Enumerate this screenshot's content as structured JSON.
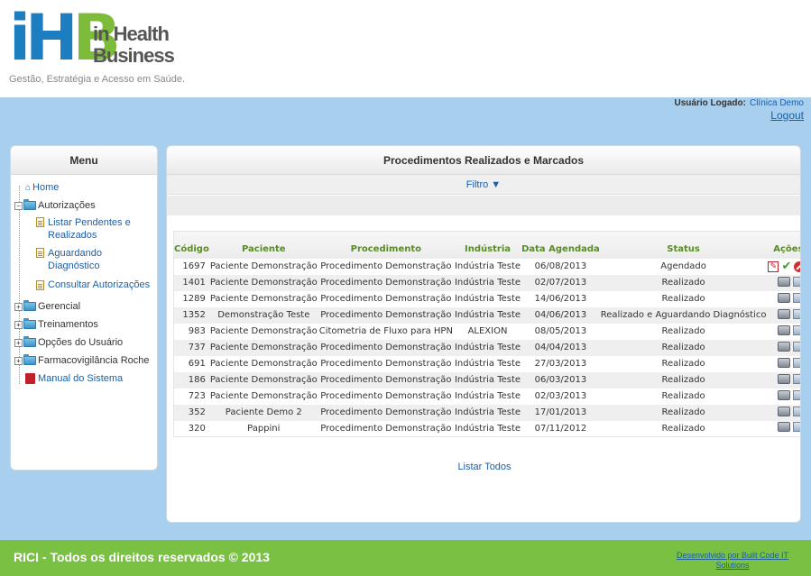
{
  "brand": {
    "letters": [
      "i",
      "H",
      "B"
    ],
    "line1": "in Health",
    "line2": "Business",
    "tagline": "Gestão, Estratégia e Acesso em Saúde.",
    "colors": {
      "blue": "#1d7dc1",
      "green": "#7dbb3a"
    }
  },
  "user": {
    "label": "Usuário Logado:",
    "name": "Clínica Demo",
    "logout": "Logout"
  },
  "menu": {
    "title": "Menu",
    "home": "Home",
    "autorizacoes": "Autorizações",
    "autorizacoes_items": [
      "Listar Pendentes e Realizados",
      "Aguardando Diagnóstico",
      "Consultar Autorizações"
    ],
    "gerencial": "Gerencial",
    "treinamentos": "Treinamentos",
    "opcoes": "Opções do Usuário",
    "farmaco": "Farmacovigilância Roche",
    "manual": "Manual do Sistema",
    "expand_symbol": "+",
    "collapse_symbol": "−"
  },
  "main": {
    "title": "Procedimentos Realizados e Marcados",
    "filter": "Filtro ▼",
    "list_all": "Listar Todos",
    "columns": [
      "Código",
      "Paciente",
      "Procedimento",
      "Indústria",
      "Data Agendada",
      "Status",
      "Ações"
    ],
    "rows": [
      {
        "code": "1697",
        "patient": "Paciente Demonstração",
        "procedure": "Procedimento Demonstração",
        "industry": "Indústria Teste",
        "date": "06/08/2013",
        "status": "Agendado",
        "actions": "pending"
      },
      {
        "code": "1401",
        "patient": "Paciente Demonstração",
        "procedure": "Procedimento Demonstração",
        "industry": "Indústria Teste",
        "date": "02/07/2013",
        "status": "Realizado",
        "actions": "done"
      },
      {
        "code": "1289",
        "patient": "Paciente Demonstração",
        "procedure": "Procedimento Demonstração",
        "industry": "Indústria Teste",
        "date": "14/06/2013",
        "status": "Realizado",
        "actions": "done"
      },
      {
        "code": "1352",
        "patient": "Demonstração Teste",
        "procedure": "Procedimento Demonstração",
        "industry": "Indústria Teste",
        "date": "04/06/2013",
        "status": "Realizado e Aguardando Diagnóstico",
        "actions": "done"
      },
      {
        "code": "983",
        "patient": "Paciente Demonstração",
        "procedure": "Citometria de Fluxo para HPN",
        "industry": "ALEXION",
        "date": "08/05/2013",
        "status": "Realizado",
        "actions": "done"
      },
      {
        "code": "737",
        "patient": "Paciente Demonstração",
        "procedure": "Procedimento Demonstração",
        "industry": "Indústria Teste",
        "date": "04/04/2013",
        "status": "Realizado",
        "actions": "done"
      },
      {
        "code": "691",
        "patient": "Paciente Demonstração",
        "procedure": "Procedimento Demonstração",
        "industry": "Indústria Teste",
        "date": "27/03/2013",
        "status": "Realizado",
        "actions": "done"
      },
      {
        "code": "186",
        "patient": "Paciente Demonstração",
        "procedure": "Procedimento Demonstração",
        "industry": "Indústria Teste",
        "date": "06/03/2013",
        "status": "Realizado",
        "actions": "done"
      },
      {
        "code": "723",
        "patient": "Paciente Demonstração",
        "procedure": "Procedimento Demonstração",
        "industry": "Indústria Teste",
        "date": "02/03/2013",
        "status": "Realizado",
        "actions": "done"
      },
      {
        "code": "352",
        "patient": "Paciente Demo 2",
        "procedure": "Procedimento Demonstração",
        "industry": "Indústria Teste",
        "date": "17/01/2013",
        "status": "Realizado",
        "actions": "done"
      },
      {
        "code": "320",
        "patient": "Pappini",
        "procedure": "Procedimento Demonstração",
        "industry": "Indústria Teste",
        "date": "07/11/2012",
        "status": "Realizado",
        "actions": "done"
      }
    ]
  },
  "footer": {
    "copyright": "RICI - Todos os direitos reservados © 2013",
    "developer": "Desenvolvido por Built Code IT Solutions"
  },
  "icons": {
    "home": "house-icon",
    "folder": "folder-icon",
    "document": "document-icon",
    "manual": "pdf-icon",
    "print": "printer-icon",
    "user": "user-card-icon",
    "check": "check-icon",
    "cancel": "cancel-icon",
    "check_glyph": "✔",
    "pdf_glyph": "✎",
    "home_glyph": "⌂"
  },
  "colors": {
    "band": "#a9cfee",
    "footer": "#79c043",
    "link": "#1a5fa8",
    "header_text": "#5a8a2a"
  }
}
